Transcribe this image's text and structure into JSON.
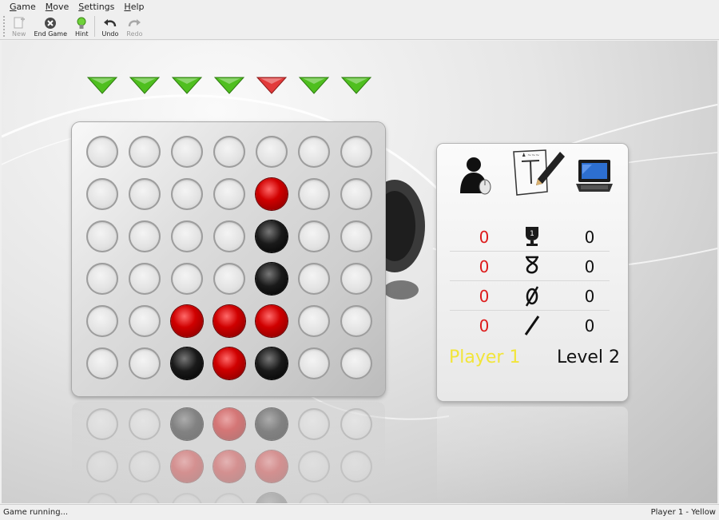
{
  "menu": [
    {
      "first": "G",
      "rest": "ame"
    },
    {
      "first": "M",
      "rest": "ove"
    },
    {
      "first": "S",
      "rest": "ettings"
    },
    {
      "first": "H",
      "rest": "elp"
    }
  ],
  "toolbar": {
    "new_label": "New",
    "end_game_label": "End Game",
    "hint_label": "Hint",
    "undo_label": "Undo",
    "redo_label": "Redo"
  },
  "board": {
    "rows": 6,
    "cols": 7,
    "cells": [
      [
        "empty",
        "empty",
        "empty",
        "empty",
        "empty",
        "empty",
        "empty"
      ],
      [
        "empty",
        "empty",
        "empty",
        "empty",
        "red",
        "empty",
        "empty"
      ],
      [
        "empty",
        "empty",
        "empty",
        "empty",
        "black",
        "empty",
        "empty"
      ],
      [
        "empty",
        "empty",
        "empty",
        "empty",
        "black",
        "empty",
        "empty"
      ],
      [
        "empty",
        "empty",
        "red",
        "red",
        "red",
        "empty",
        "empty"
      ],
      [
        "empty",
        "empty",
        "black",
        "red",
        "black",
        "empty",
        "empty"
      ]
    ],
    "column_arrows": [
      "green",
      "green",
      "green",
      "green",
      "red",
      "green",
      "green"
    ]
  },
  "colors": {
    "arrow_green": "#4fbf1f",
    "arrow_red": "#e23a3a",
    "player1_score": "#dd1b1b",
    "player_label": "#f2e53a"
  },
  "stats": {
    "rows": [
      {
        "icon": "trophy-icon",
        "p1": "0",
        "p2": "0"
      },
      {
        "icon": "loss-icon",
        "p1": "0",
        "p2": "0"
      },
      {
        "icon": "draw-icon",
        "p1": "0",
        "p2": "0"
      },
      {
        "icon": "abort-icon",
        "p1": "0",
        "p2": "0"
      }
    ],
    "player_label": "Player 1",
    "level_label": "Level 2"
  },
  "status": {
    "left": "Game running...",
    "right": "Player 1 - Yellow"
  }
}
